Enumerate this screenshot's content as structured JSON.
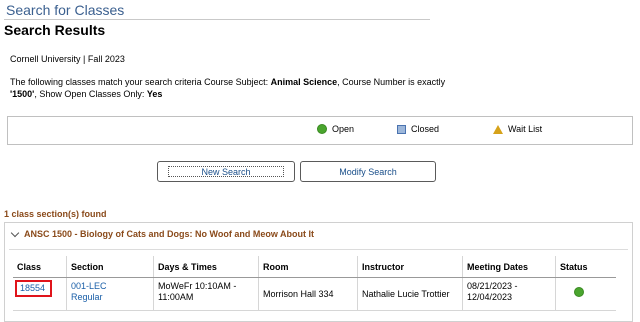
{
  "page": {
    "heading": "Search for Classes",
    "results_title": "Search Results",
    "term": "Cornell University | Fall 2023",
    "criteria": {
      "prefix": "The following classes match your search criteria Course Subject: ",
      "subject": "Animal Science",
      "mid": ",  Course Number is exactly",
      "number": "'1500'",
      "open_label": ",  Show Open Classes Only: ",
      "open_value": "Yes"
    }
  },
  "legend": {
    "open": "Open",
    "closed": "Closed",
    "wait_list": "Wait List"
  },
  "buttons": {
    "new_search": "New Search",
    "modify_search": "Modify Search"
  },
  "results": {
    "count_text": "1 class section(s) found",
    "course_title": "ANSC 1500 - Biology of Cats and Dogs: No Woof and Meow About It",
    "columns": [
      "Class",
      "Section",
      "Days & Times",
      "Room",
      "Instructor",
      "Meeting Dates",
      "Status"
    ],
    "rows": [
      {
        "class_nbr": "18554",
        "section_line1": "001-LEC",
        "section_line2": "Regular",
        "days_line1": "MoWeFr 10:10AM -",
        "days_line2": "11:00AM",
        "room": "Morrison Hall 334",
        "instructor": "Nathalie Lucie Trottier",
        "dates_line1": "08/21/2023 -",
        "dates_line2": "12/04/2023",
        "status_icon": "open-status-icon"
      }
    ]
  },
  "colors": {
    "link": "#1a5fa8",
    "heading": "#3a5f8f",
    "section_title": "#8a4a1a",
    "open": "#4aa52e",
    "highlight": "#e0141b"
  }
}
